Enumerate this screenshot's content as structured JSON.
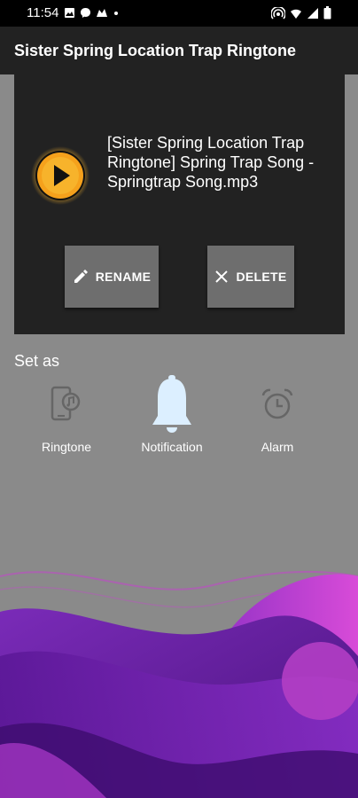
{
  "status_bar": {
    "time": "11:54",
    "left_icons": [
      "gallery-icon",
      "messenger-icon",
      "app-icon",
      "dot-icon"
    ],
    "right_icons": [
      "hotspot-icon",
      "wifi-icon",
      "signal-icon",
      "battery-icon"
    ]
  },
  "app_bar": {
    "title": "Sister Spring Location Trap Ringtone"
  },
  "player": {
    "file_name": "[Sister Spring Location Trap Ringtone] Spring Trap Song - Springtrap Song.mp3",
    "rename_label": "RENAME",
    "delete_label": "DELETE"
  },
  "set_as": {
    "title": "Set as",
    "options": [
      {
        "label": "Ringtone",
        "icon": "phone-ringtone-icon"
      },
      {
        "label": "Notification",
        "icon": "bell-icon",
        "selected": true
      },
      {
        "label": "Alarm",
        "icon": "alarm-clock-icon"
      }
    ]
  },
  "colors": {
    "background": "#8a8a8a",
    "card": "#222222",
    "accent_orange": "#f5a11c",
    "bell_selected": "#dcefff",
    "wave_purple": "#6a1fa0",
    "wave_magenta": "#c03bd0"
  }
}
